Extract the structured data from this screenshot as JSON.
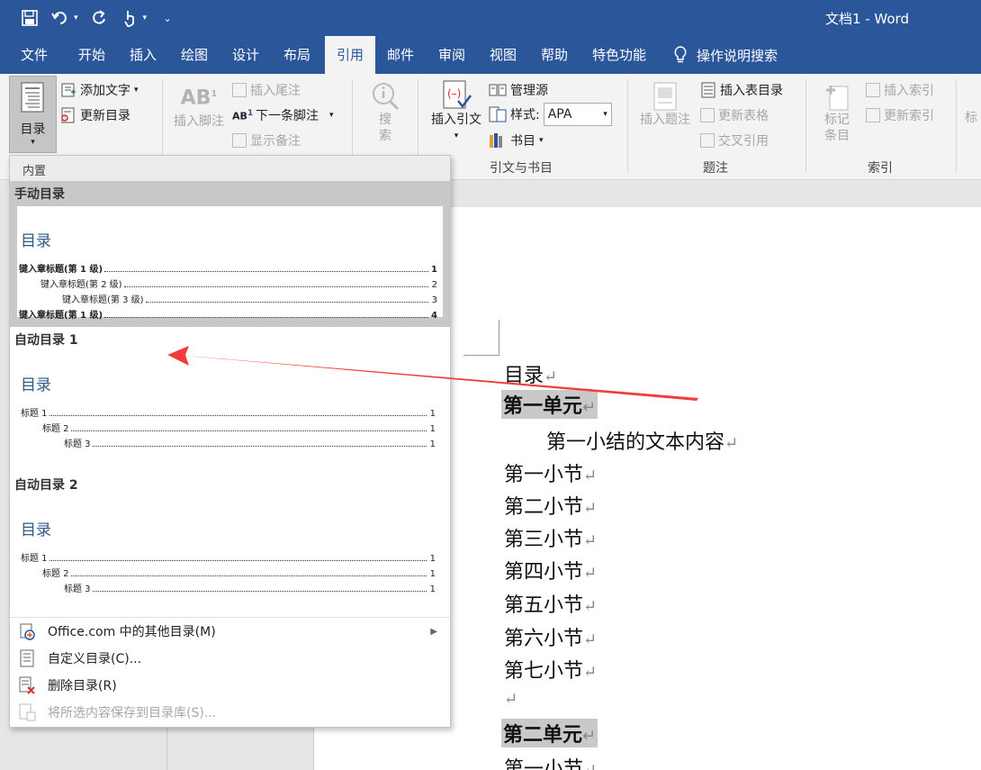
{
  "window": {
    "title": "文档1  -  Word"
  },
  "qat": {
    "icons": [
      "save-icon",
      "undo-icon",
      "redo-icon",
      "touch-icon",
      "customize-icon"
    ]
  },
  "tabs": [
    {
      "label": "文件"
    },
    {
      "label": "开始"
    },
    {
      "label": "插入"
    },
    {
      "label": "绘图"
    },
    {
      "label": "设计"
    },
    {
      "label": "布局"
    },
    {
      "label": "引用",
      "active": true
    },
    {
      "label": "邮件"
    },
    {
      "label": "审阅"
    },
    {
      "label": "视图"
    },
    {
      "label": "帮助"
    },
    {
      "label": "特色功能"
    }
  ],
  "tell_me": "操作说明搜索",
  "ribbon": {
    "toc_button": "目录",
    "add_text": "添加文字",
    "update_toc": "更新目录",
    "insert_footnote": "插入脚注",
    "insert_endnote": "插入尾注",
    "next_footnote": "下一条脚注",
    "show_notes": "显示备注",
    "search_top": "搜",
    "search_bottom": "索",
    "insert_citation": "插入引文",
    "manage_sources": "管理源",
    "style_label": "样式:",
    "style_value": "APA",
    "bibliography": "书目",
    "group_citations": "引文与书目",
    "insert_caption": "插入题注",
    "insert_table_figures": "插入表目录",
    "update_table": "更新表格",
    "cross_reference": "交叉引用",
    "group_captions": "题注",
    "mark_entry_top": "标记",
    "mark_entry_bottom": "条目",
    "insert_index": "插入索引",
    "update_index": "更新索引",
    "group_index": "索引",
    "partial_next": "标"
  },
  "dropdown": {
    "header": "内置",
    "items": [
      {
        "title": "手动目录",
        "heading": "目录",
        "rows": [
          {
            "text": "键入章标题(第 1 级)",
            "page": "1",
            "level": 1,
            "bold": true
          },
          {
            "text": "键入章标题(第 2 级)",
            "page": "2",
            "level": 2,
            "bold": false
          },
          {
            "text": "键入章标题(第 3 级)",
            "page": "3",
            "level": 3,
            "bold": false
          },
          {
            "text": "键入章标题(第 1 级)",
            "page": "4",
            "level": 1,
            "bold": true
          }
        ]
      },
      {
        "title": "自动目录 1",
        "heading": "目录",
        "rows": [
          {
            "text": "标题 1",
            "page": "1",
            "level": 1
          },
          {
            "text": "标题 2",
            "page": "1",
            "level": 2
          },
          {
            "text": "标题 3",
            "page": "1",
            "level": 3
          }
        ]
      },
      {
        "title": "自动目录 2",
        "heading": "目录",
        "rows": [
          {
            "text": "标题 1",
            "page": "1",
            "level": 1
          },
          {
            "text": "标题 2",
            "page": "1",
            "level": 2
          },
          {
            "text": "标题 3",
            "page": "1",
            "level": 3
          }
        ]
      }
    ],
    "menu": [
      {
        "label": "Office.com 中的其他目录(M)",
        "icon": "office-icon"
      },
      {
        "label": "自定义目录(C)...",
        "icon": "custom-toc-icon"
      },
      {
        "label": "删除目录(R)",
        "icon": "remove-toc-icon"
      },
      {
        "label": "将所选内容保存到目录库(S)...",
        "icon": "save-gallery-icon"
      }
    ]
  },
  "document": {
    "pilcrow": "↵",
    "lines": [
      {
        "text": "目录"
      },
      {
        "text": "第一单元",
        "heading": true
      },
      {
        "text": "第一小结的文本内容"
      },
      {
        "text": "第一小节"
      },
      {
        "text": "第二小节"
      },
      {
        "text": "第三小节"
      },
      {
        "text": "第四小节"
      },
      {
        "text": "第五小节"
      },
      {
        "text": "第六小节"
      },
      {
        "text": "第七小节"
      },
      {
        "text": ""
      },
      {
        "text": "第二单元",
        "heading": true
      },
      {
        "text": "第一小节"
      }
    ]
  },
  "colors": {
    "accent": "#2b579a",
    "ribbon_bg": "#f3f3f3",
    "annotation": "#f03c3c",
    "toc_heading": "#2e5a8a"
  }
}
